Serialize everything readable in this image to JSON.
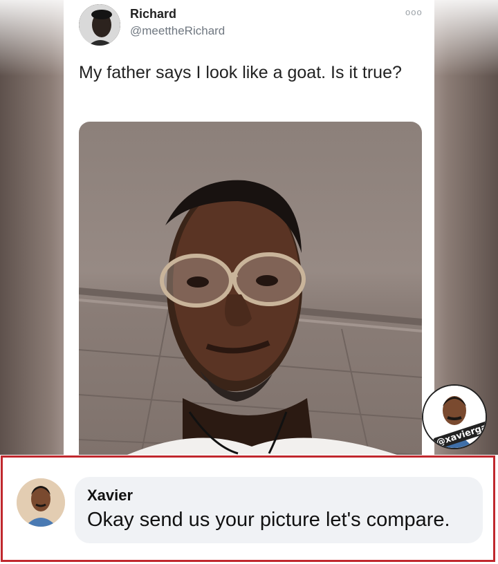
{
  "tweet": {
    "author_name": "Richard",
    "author_handle": "@meettheRichard",
    "menu_glyph": "ooo",
    "text": "My father says I look like a goat. Is it true?",
    "image_description_icon": "selfie-photo"
  },
  "watermark": {
    "handle": "@xaviergazm"
  },
  "comment": {
    "author": "Xavier",
    "text": "Okay send us your picture let's compare."
  },
  "colors": {
    "frame_border": "#c0272d",
    "bubble_bg": "#f0f2f5",
    "handle_gray": "#6f7780"
  }
}
